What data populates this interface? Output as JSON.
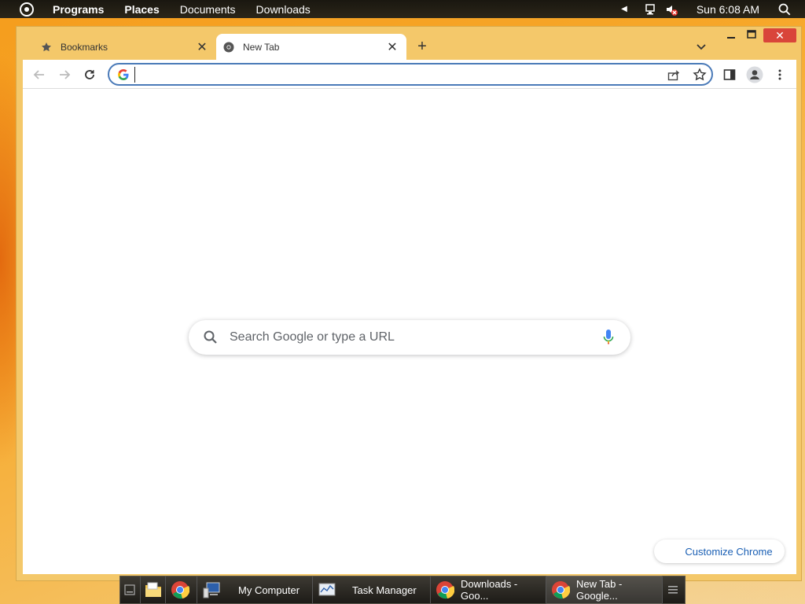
{
  "top_panel": {
    "menu": [
      "Programs",
      "Places",
      "Documents",
      "Downloads"
    ],
    "clock": "Sun 6:08 AM"
  },
  "browser": {
    "tabs": [
      {
        "label": "Bookmarks",
        "icon": "star-icon"
      },
      {
        "label": "New Tab",
        "icon": "chrome-icon",
        "active": true
      }
    ],
    "omnibox": {
      "value": "",
      "placeholder": ""
    },
    "ntp": {
      "search_placeholder": "Search Google or type a URL",
      "customize_label": "Customize Chrome"
    }
  },
  "taskbar": {
    "items": [
      {
        "label": "",
        "icon": "show-desktop-icon"
      },
      {
        "label": "",
        "icon": "file-manager-icon"
      },
      {
        "label": "",
        "icon": "chrome-icon"
      },
      {
        "label": "My Computer",
        "icon": "computer-icon"
      },
      {
        "label": "Task Manager",
        "icon": "task-manager-icon"
      },
      {
        "label": "Downloads - Goo...",
        "icon": "chrome-icon"
      },
      {
        "label": "New Tab - Google...",
        "icon": "chrome-icon"
      }
    ]
  },
  "colors": {
    "accent": "#1a73e8",
    "window_frame": "#f4c86a",
    "close_button": "#d9453a",
    "customize_text": "#1a5fb4"
  }
}
